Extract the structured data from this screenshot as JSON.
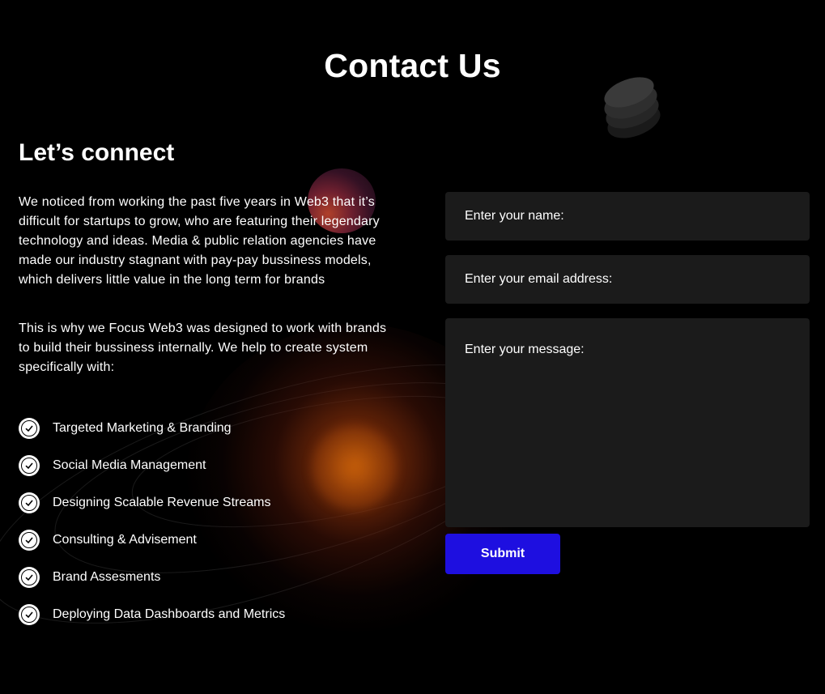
{
  "header": {
    "title": "Contact Us"
  },
  "intro": {
    "heading": "Let’s connect",
    "paragraph1": "We noticed from working the past five years in Web3 that it’s difficult for startups to grow, who are featuring their legendary technology and ideas. Media & public relation agencies have made our industry stagnant with pay-pay bussiness models, which delivers little value in the long term for brands",
    "paragraph2": "This is why we Focus Web3 was designed  to work with brands to build their bussiness internally. We help to create  system specifically with:"
  },
  "services": [
    "Targeted Marketing & Branding",
    "Social Media Management",
    "Designing Scalable  Revenue Streams",
    "Consulting & Advisement",
    "Brand Assesments",
    "Deploying Data Dashboards and Metrics"
  ],
  "form": {
    "name_placeholder": "Enter your name:",
    "email_placeholder": "Enter your email address:",
    "message_placeholder": "Enter your message:",
    "submit_label": "Submit"
  },
  "colors": {
    "background": "#000000",
    "field_background": "#1b1b1b",
    "submit_accent": "#1e0fe0",
    "glow": "#a8500a"
  },
  "icons": {
    "service_bullet": "check-circle-icon"
  }
}
